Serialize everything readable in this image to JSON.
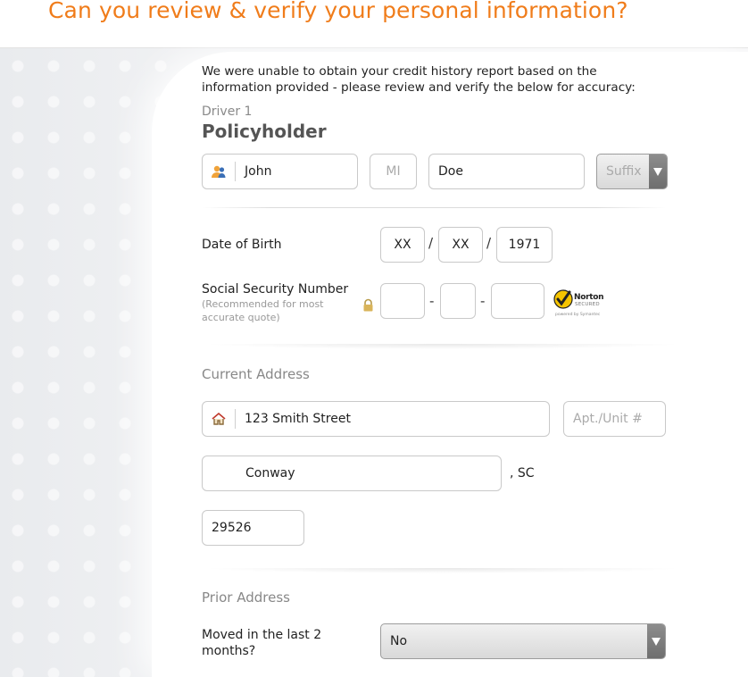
{
  "header": {
    "title": "Can you review & verify your personal information?"
  },
  "intro": {
    "line1": "We were unable to obtain your credit history report based on the",
    "line2": "information provided - please review and verify the below for accuracy:"
  },
  "driver": {
    "label": "Driver 1",
    "name": "Policyholder"
  },
  "name_fields": {
    "first": "John",
    "middle_placeholder": "MI",
    "last": "Doe",
    "suffix_placeholder": "Suffix"
  },
  "dob": {
    "label": "Date of Birth",
    "month": "XX",
    "day": "XX",
    "year": "1971",
    "separator": "/"
  },
  "ssn": {
    "label": "Social Security Number",
    "note_line1": "(Recommended for most",
    "note_line2": "accurate quote)",
    "separator": "-"
  },
  "norton": {
    "brand": "Norton",
    "tag": "SECURED",
    "powered": "powered by Symantec"
  },
  "current_address": {
    "title": "Current Address",
    "street": "123 Smith Street",
    "apt_placeholder": "Apt./Unit #",
    "city": "Conway",
    "state": ", SC",
    "zip": "29526"
  },
  "prior_address": {
    "title": "Prior Address",
    "moved_label_line1": "Moved in the last 2",
    "moved_label_line2": "months?",
    "moved_value": "No"
  },
  "colors": {
    "accent": "#f07c1a",
    "norton_yellow": "#f5c400"
  },
  "icons": {
    "person": "person-icon",
    "home": "home-icon",
    "lock": "lock-icon",
    "dropdown": "chevron-down-icon"
  }
}
